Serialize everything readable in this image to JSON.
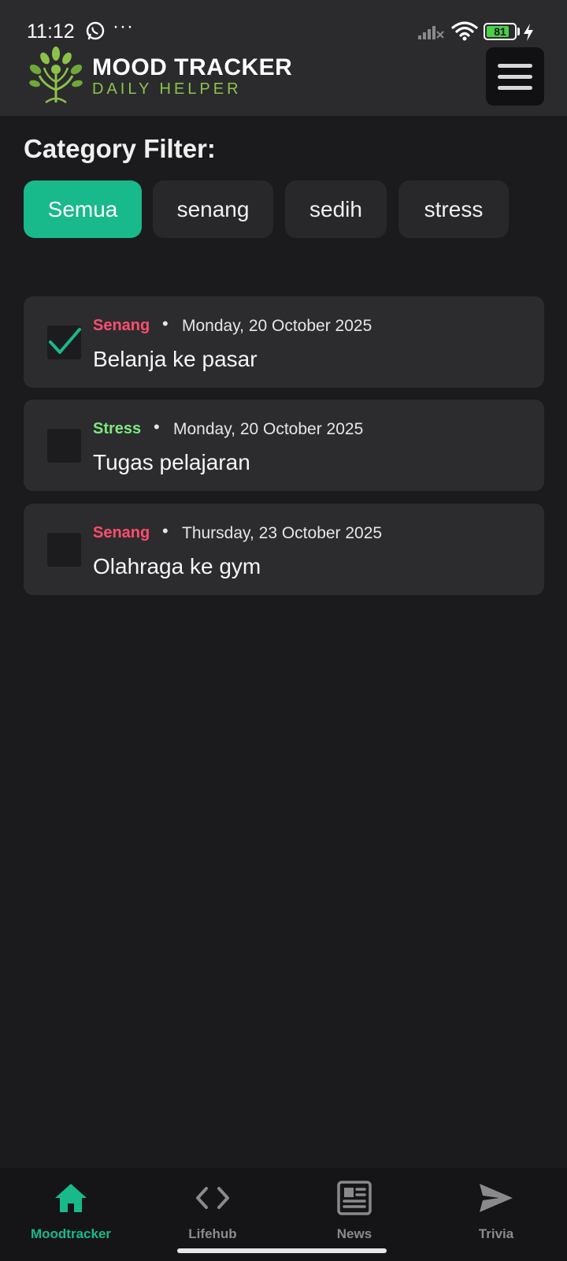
{
  "status_bar": {
    "time": "11:12",
    "dots": "···",
    "battery": "81",
    "battery_level": 0.81,
    "icons": [
      "whatsapp-icon",
      "signal-icon",
      "wifi-icon",
      "battery-icon",
      "charging-icon"
    ]
  },
  "header": {
    "title": "MOOD TRACKER",
    "subtitle": "DAILY HELPER",
    "logo_icon": "tree-logo-icon",
    "menu_icon": "hamburger-menu-icon"
  },
  "filter": {
    "heading": "Category Filter:",
    "chips": [
      {
        "label": "Semua",
        "active": true
      },
      {
        "label": "senang",
        "active": false
      },
      {
        "label": "sedih",
        "active": false
      },
      {
        "label": "stress",
        "active": false
      }
    ]
  },
  "entries": [
    {
      "category": "Senang",
      "category_color": "#ff4d6d",
      "date": "Monday, 20 October 2025",
      "title": "Belanja ke pasar",
      "checked": true
    },
    {
      "category": "Stress",
      "category_color": "#7ee87e",
      "date": "Monday, 20 October 2025",
      "title": "Tugas pelajaran",
      "checked": false
    },
    {
      "category": "Senang",
      "category_color": "#ff4d6d",
      "date": "Thursday, 23 October 2025",
      "title": "Olahraga ke gym",
      "checked": false
    }
  ],
  "bullet": "•",
  "bottom_nav": [
    {
      "label": "Moodtracker",
      "icon": "home-icon",
      "active": true
    },
    {
      "label": "Lifehub",
      "icon": "code-icon",
      "active": false
    },
    {
      "label": "News",
      "icon": "newspaper-icon",
      "active": false
    },
    {
      "label": "Trivia",
      "icon": "send-icon",
      "active": false
    }
  ],
  "colors": {
    "accent": "#18b98a",
    "background": "#1b1b1e",
    "header": "#2b2b2e",
    "card": "#2c2c2f",
    "subtitle": "#8bc34a"
  }
}
